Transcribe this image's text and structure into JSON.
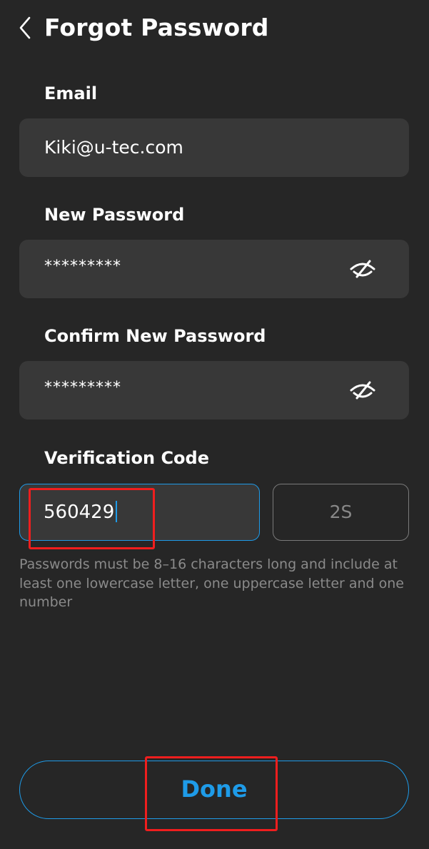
{
  "header": {
    "back_icon": "chevron-left-icon",
    "title": "Forgot Password"
  },
  "email": {
    "label": "Email",
    "value": "Kiki@u-tec.com"
  },
  "new_password": {
    "label": "New Password",
    "value": "*********",
    "toggle_icon": "eye-off-icon"
  },
  "confirm_password": {
    "label": "Confirm New Password",
    "value": "*********",
    "toggle_icon": "eye-off-icon"
  },
  "verification": {
    "label": "Verification Code",
    "value": "560429",
    "timer": "2S"
  },
  "hint": "Passwords must be 8–16 characters long and include at least one lowercase letter, one uppercase letter and one number",
  "done_label": "Done",
  "colors": {
    "background": "#262626",
    "field": "#383838",
    "accent": "#1e9be8",
    "annotation": "#f01e1e"
  }
}
